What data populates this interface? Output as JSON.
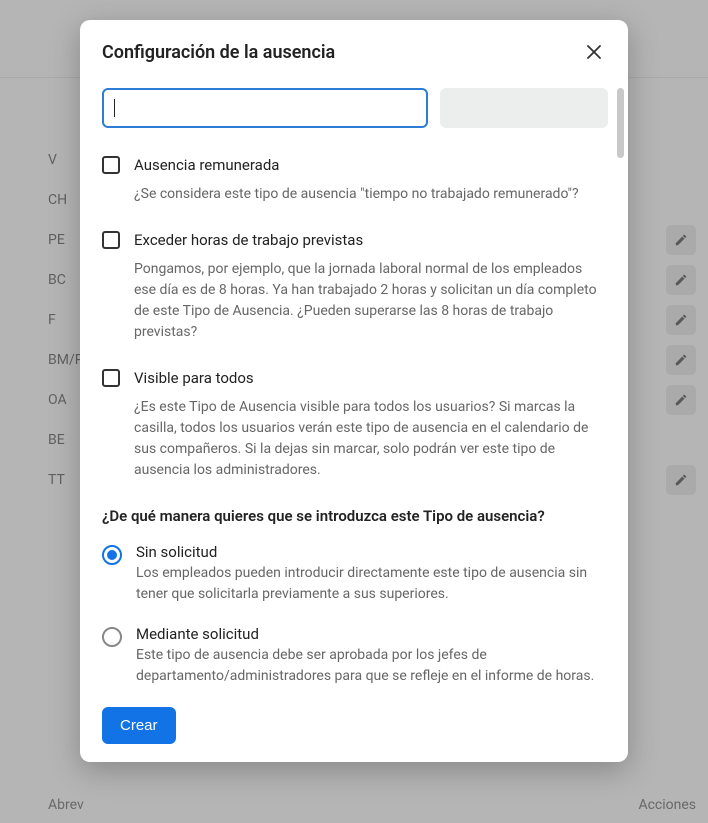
{
  "background": {
    "header_abbrev": "Abrev",
    "header_actions": "Acciones",
    "rows": [
      {
        "abbrev": "V",
        "editable": false
      },
      {
        "abbrev": "CH",
        "editable": false
      },
      {
        "abbrev": "PE",
        "editable": true
      },
      {
        "abbrev": "BC",
        "editable": true
      },
      {
        "abbrev": "F",
        "editable": true
      },
      {
        "abbrev": "BM/P",
        "editable": true
      },
      {
        "abbrev": "OA",
        "editable": true
      },
      {
        "abbrev": "BE",
        "editable": false
      },
      {
        "abbrev": "TT",
        "editable": true
      }
    ]
  },
  "modal": {
    "title": "Configuración de la ausencia",
    "name_value": "",
    "checks": {
      "paid": {
        "label": "Ausencia remunerada",
        "desc": "¿Se considera este tipo de ausencia \"tiempo no trabajado remunerado\"?"
      },
      "exceed": {
        "label": "Exceder horas de trabajo previstas",
        "desc": "Pongamos, por ejemplo, que la jornada laboral normal de los empleados ese día es de 8 horas. Ya han trabajado 2 horas y solicitan un día completo de este Tipo de Ausencia. ¿Pueden superarse las 8 horas de trabajo previstas?"
      },
      "visible": {
        "label": "Visible para todos",
        "desc": "¿Es este Tipo de Ausencia visible para todos los usuarios? Si marcas la casilla, todos los usuarios verán este tipo de ausencia en el calendario de sus compañeros. Si la dejas sin marcar, solo podrán ver este tipo de ausencia los administradores."
      }
    },
    "entry_question": "¿De qué manera quieres que se introduzca este Tipo de ausencia?",
    "radios": {
      "no_request": {
        "title": "Sin solicitud",
        "desc": "Los empleados pueden introducir directamente este tipo de ausencia sin tener que solicitarla previamente a sus superiores.",
        "selected": true
      },
      "request": {
        "title": "Mediante solicitud",
        "desc": "Este tipo de ausencia debe ser aprobada por los jefes de departamento/administradores para que se refleje en el informe de horas.",
        "selected": false
      }
    },
    "create_label": "Crear"
  }
}
